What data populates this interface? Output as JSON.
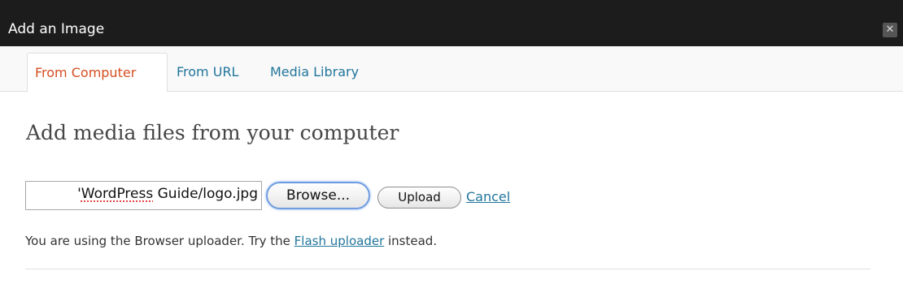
{
  "window": {
    "title": "Add an Image",
    "close_glyph": "✕"
  },
  "tabs": [
    {
      "label": "From Computer",
      "active": true
    },
    {
      "label": "From URL",
      "active": false
    },
    {
      "label": "Media Library",
      "active": false
    }
  ],
  "main": {
    "heading": "Add media files from your computer",
    "file_field": {
      "value_prefix": "'",
      "value_word": "WordPress",
      "value_suffix": " Guide/logo.jpg"
    },
    "browse_label": "Browse...",
    "upload_label": "Upload",
    "cancel_label": "Cancel",
    "info": {
      "before": "You are using the Browser uploader. Try the ",
      "link": "Flash uploader",
      "after": " instead."
    }
  },
  "colors": {
    "title_bar": "#1c1c1c",
    "active_tab_text": "#d54e21",
    "link": "#21759b"
  },
  "icons": {
    "close": "close-icon"
  }
}
